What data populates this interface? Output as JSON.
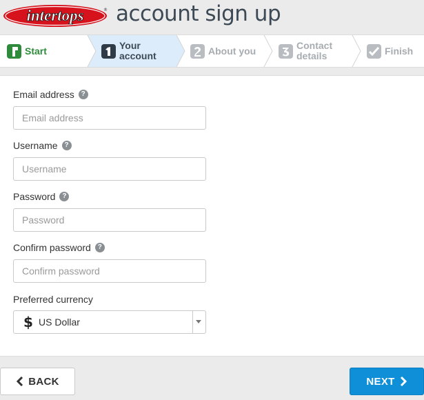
{
  "header": {
    "logo_text": "intertops",
    "title": "account sign up"
  },
  "steps": [
    {
      "label": "Start",
      "state": "done"
    },
    {
      "label": "Your\naccount",
      "state": "active"
    },
    {
      "label": "About you",
      "state": "inactive"
    },
    {
      "label": "Contact\ndetails",
      "state": "inactive"
    },
    {
      "label": "Finish",
      "state": "inactive"
    }
  ],
  "form": {
    "email": {
      "label": "Email address",
      "placeholder": "Email address",
      "value": ""
    },
    "username": {
      "label": "Username",
      "placeholder": "Username",
      "value": ""
    },
    "password": {
      "label": "Password",
      "placeholder": "Password",
      "value": ""
    },
    "confirm_password": {
      "label": "Confirm password",
      "placeholder": "Confirm password",
      "value": ""
    },
    "currency": {
      "label": "Preferred currency",
      "symbol": "$",
      "selected": "US Dollar"
    },
    "help_glyph": "?"
  },
  "footer": {
    "back_label": "BACK",
    "next_label": "NEXT"
  },
  "colors": {
    "brand_red": "#d6121d",
    "active_step_bg": "#dcecfa",
    "start_green": "#2e8b3c",
    "next_blue": "#0e8fd8",
    "title_gray": "#3d4a56"
  },
  "icons": {
    "step_start": "flag-step-1-icon",
    "step_account": "number-1-icon",
    "step_about": "number-2-icon",
    "step_contact": "number-3-icon",
    "step_finish": "checkmark-icon",
    "help": "question-circle-icon",
    "dropdown": "caret-down-icon",
    "back": "chevron-left-icon",
    "next": "chevron-right-icon"
  }
}
